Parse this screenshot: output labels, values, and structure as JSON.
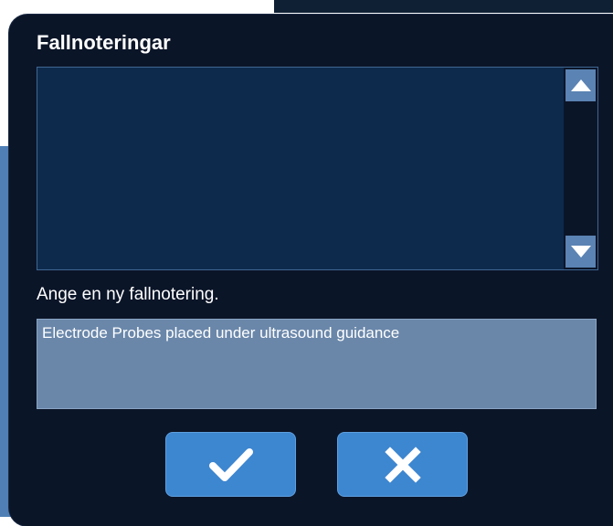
{
  "dialog": {
    "title": "Fallnoteringar",
    "notes": [],
    "prompt": "Ange en ny fallnotering.",
    "input_value": "Electrode Probes placed under ultrasound guidance",
    "input_placeholder": ""
  },
  "scrollbar": {
    "up_icon": "arrow-up-icon",
    "down_icon": "arrow-down-icon"
  },
  "buttons": {
    "confirm_icon": "checkmark-icon",
    "cancel_icon": "close-icon"
  },
  "colors": {
    "dialog_bg": "#0b1528",
    "list_bg": "#0d2a4d",
    "input_bg": "#6a87aa",
    "button_bg": "#3d86d0",
    "scroll_button": "#5b83b3",
    "text": "#ffffff"
  }
}
